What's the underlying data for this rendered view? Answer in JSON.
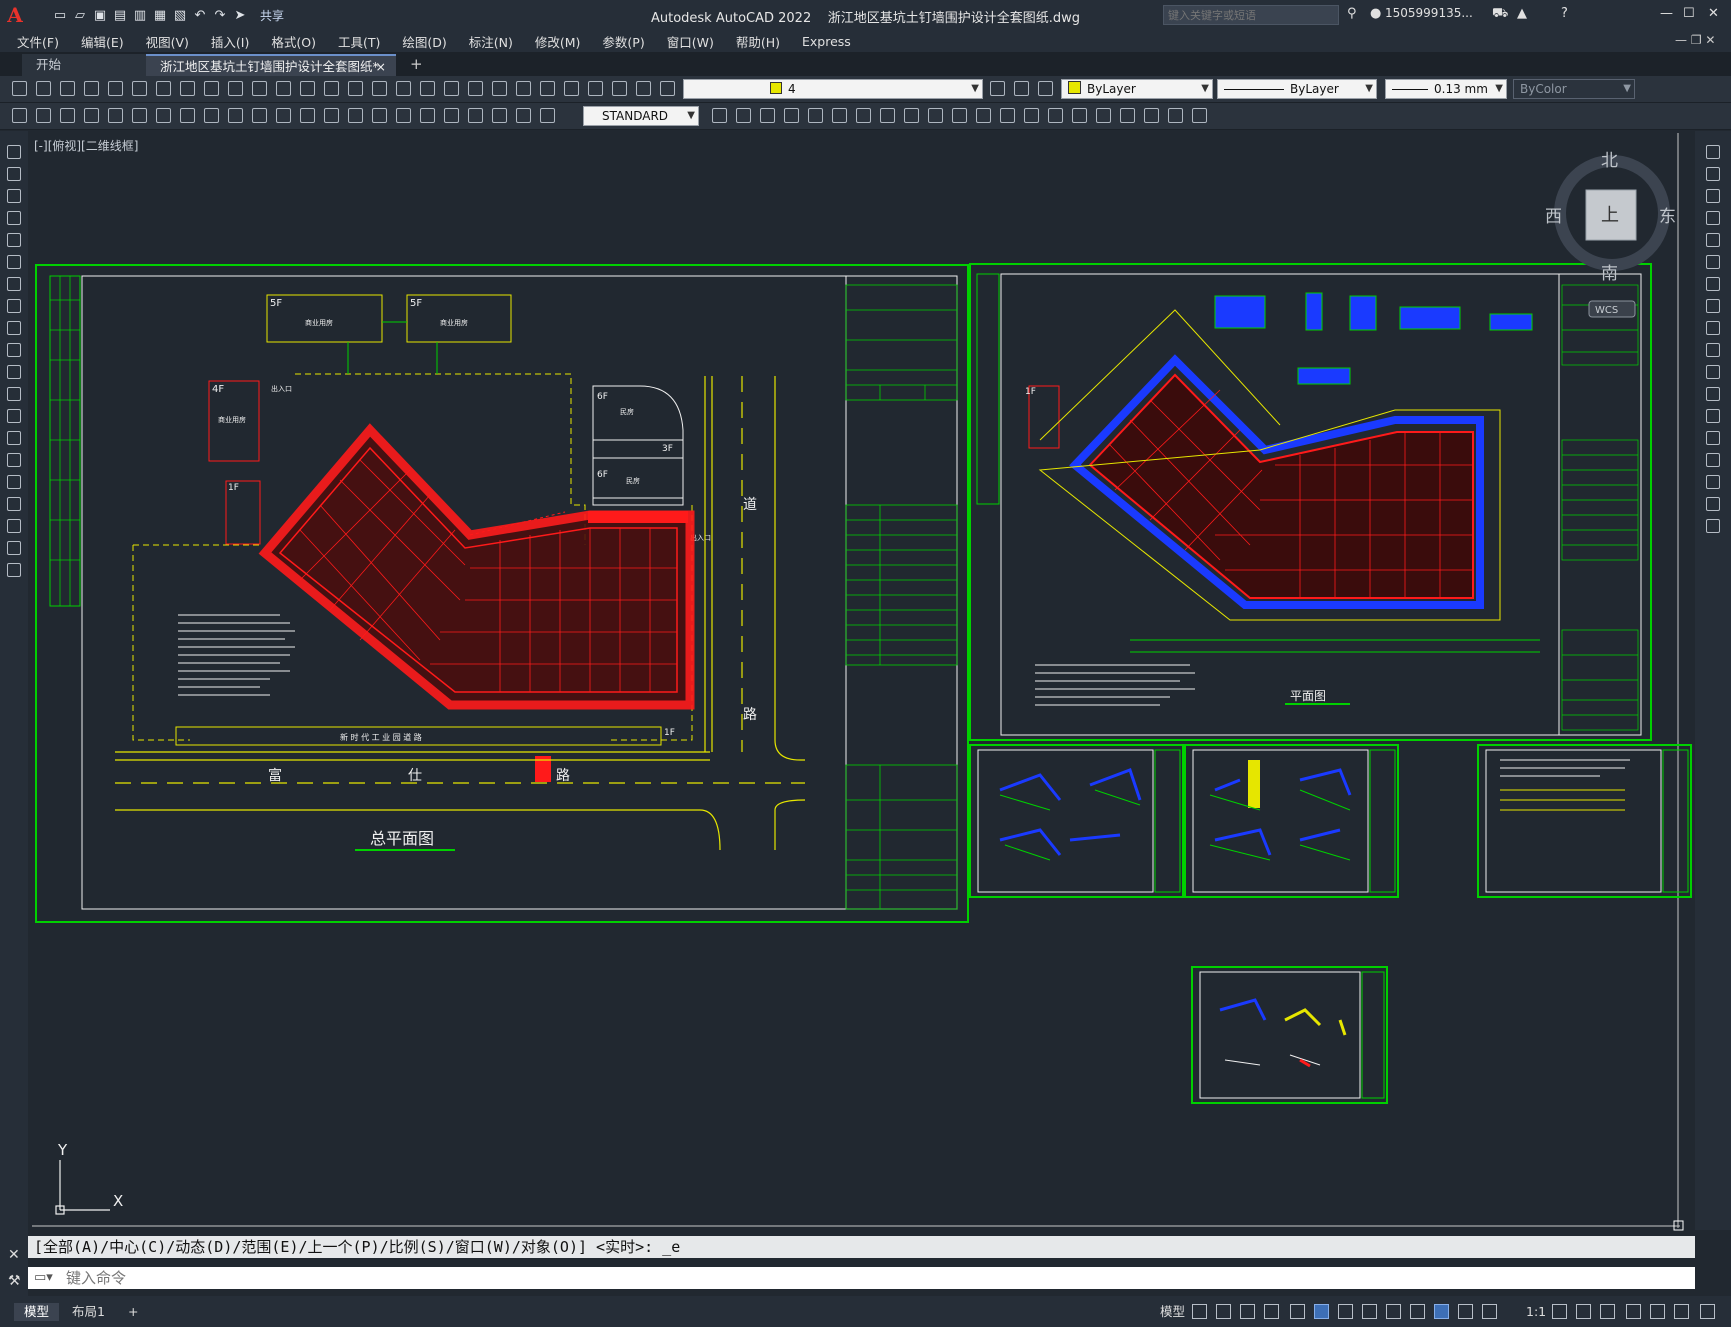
{
  "app": {
    "logo": "A",
    "title": "Autodesk AutoCAD 2022",
    "document": "浙江地区基坑土钉墙围护设计全套图纸.dwg",
    "share_label": "共享",
    "search_placeholder": "键入关键字或短语",
    "user": "1505999135..."
  },
  "menu": [
    "文件(F)",
    "编辑(E)",
    "视图(V)",
    "插入(I)",
    "格式(O)",
    "工具(T)",
    "绘图(D)",
    "标注(N)",
    "修改(M)",
    "参数(P)",
    "窗口(W)",
    "帮助(H)",
    "Express"
  ],
  "tabs": {
    "start": "开始",
    "active": "浙江地区基坑土钉墙围护设计全套图纸*",
    "close": "×",
    "add": "+"
  },
  "properties": {
    "layer": "4",
    "color": "ByLayer",
    "linetype": "ByLayer",
    "lineweight": "0.13 mm",
    "plotstyle": "ByColor",
    "textstyle": "STANDARD"
  },
  "viewport_label": "[-][俯视][二维线框]",
  "viewcube": {
    "north": "北",
    "south": "南",
    "east": "东",
    "west": "西",
    "top": "上",
    "wcs": "WCS"
  },
  "drawings": {
    "site_plan_title": "总平面图",
    "plan_title": "平面图",
    "road_left": "富",
    "road_mid": "仕",
    "road_right": "路",
    "road_vertical_1": "道",
    "road_vertical_2": "路",
    "bldg_5f_a": "5F",
    "bldg_5f_b": "5F",
    "bldg_5f_label_a": "商业用房",
    "bldg_5f_label_b": "商业用房",
    "bldg_4f": "4F",
    "bldg_4f_label": "商业用房",
    "bldg_6f_a": "6F",
    "bldg_6f_b": "6F",
    "bldg_3f": "3F",
    "bldg_1f": "1F",
    "bldg_1f_b": "1F",
    "bldg_6f_label": "民房",
    "entrance": "出入口",
    "entrance_b": "出入口",
    "bldg_6f_label_b": "民房",
    "plan_1f": "1F",
    "road_bottom": "新 时 代 工 业 园 道 路"
  },
  "ucs": {
    "x": "X",
    "y": "Y"
  },
  "command": {
    "history": "[全部(A)/中心(C)/动态(D)/范围(E)/上一个(P)/比例(S)/窗口(W)/对象(O)] <实时>: _e",
    "placeholder": "键入命令"
  },
  "status": {
    "model_tab": "模型",
    "layout_tab": "布局1",
    "add": "+",
    "model_btn": "模型",
    "scale": "1:1"
  },
  "colors": {
    "accent": "#3d6fb6",
    "frame": "#00c000",
    "red": "#ff1a1a",
    "yellow": "#e6e600",
    "blue": "#1a3aff",
    "white": "#f0f0f0",
    "bg": "#212830"
  }
}
